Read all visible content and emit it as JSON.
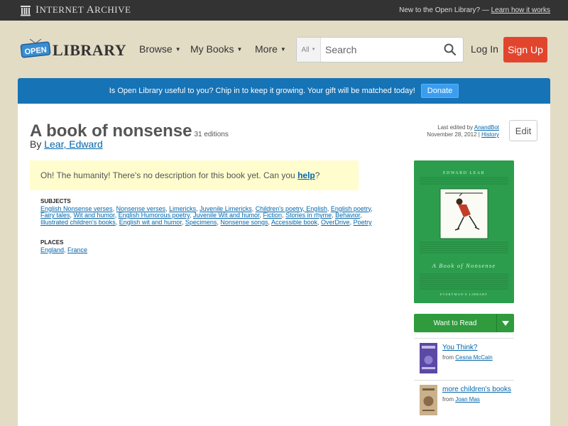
{
  "ia_bar": {
    "logo_name_first": "I",
    "logo_name_rest": "NTERNET ",
    "logo_name_second": "A",
    "logo_name_second_rest": "RCHIVE",
    "prompt": "New to the Open Library? —",
    "learn_link": "Learn how it works"
  },
  "header": {
    "logo_open": "OPEN",
    "logo_library": "LIBRARY",
    "nav": [
      {
        "label": "Browse"
      },
      {
        "label": "My Books"
      },
      {
        "label": "More"
      }
    ],
    "search": {
      "scope": "All",
      "placeholder": "Search"
    },
    "login_label": "Log In",
    "signup_label": "Sign Up"
  },
  "donate": {
    "message": "Is Open Library useful to you? Chip in to keep it growing. Your gift will be matched today!",
    "button_label": "Donate"
  },
  "work": {
    "title": "A book of nonsense",
    "editions": "31 editions",
    "by": "By",
    "author": "Lear, Edward",
    "last_edited_prefix": "Last edited by",
    "last_edited_by": "AnandBot",
    "last_edited_date": "November 28, 2012 |",
    "history_link": "History",
    "edit_label": "Edit",
    "no_description": "Oh! The humanity! There's no description for this book yet. Can you",
    "help_link": "help",
    "help_suffix": "?",
    "subjects_heading": "SUBJECTS",
    "subjects": [
      "English Nonsense verses",
      "Nonsense verses",
      "Limericks",
      "Juvenile Limericks",
      "Children's poetry, English",
      "English poetry",
      "Fairy tales",
      "Wit and humor",
      "English Humorous poetry",
      "Juvenile Wit and humor",
      "Fiction",
      "Stories in rhyme",
      "Behavior",
      "Illustrated children's books",
      "English wit and humor",
      "Specimens",
      "Nonsense songs",
      "Accessible book",
      "OverDrive",
      "Poetry"
    ],
    "places_heading": "PLACES",
    "places": [
      "England",
      "France"
    ]
  },
  "cover": {
    "author_text": "EDWARD LEAR",
    "title_text": "A Book of Nonsense",
    "publisher_text": "EVERYMAN'S LIBRARY",
    "colors": {
      "green": "#2c9d4d",
      "dark_green": "#1d6f34"
    }
  },
  "sidebar": {
    "want_label": "Want to Read",
    "lists": [
      {
        "title": "You Think?",
        "from_prefix": "from",
        "from_user": "Cesna McCain",
        "thumb_color": "#5a4aa3"
      },
      {
        "title": "more children's books",
        "from_prefix": "from",
        "from_user": "Joan Mas",
        "thumb_color": "#c9b18c"
      }
    ]
  }
}
